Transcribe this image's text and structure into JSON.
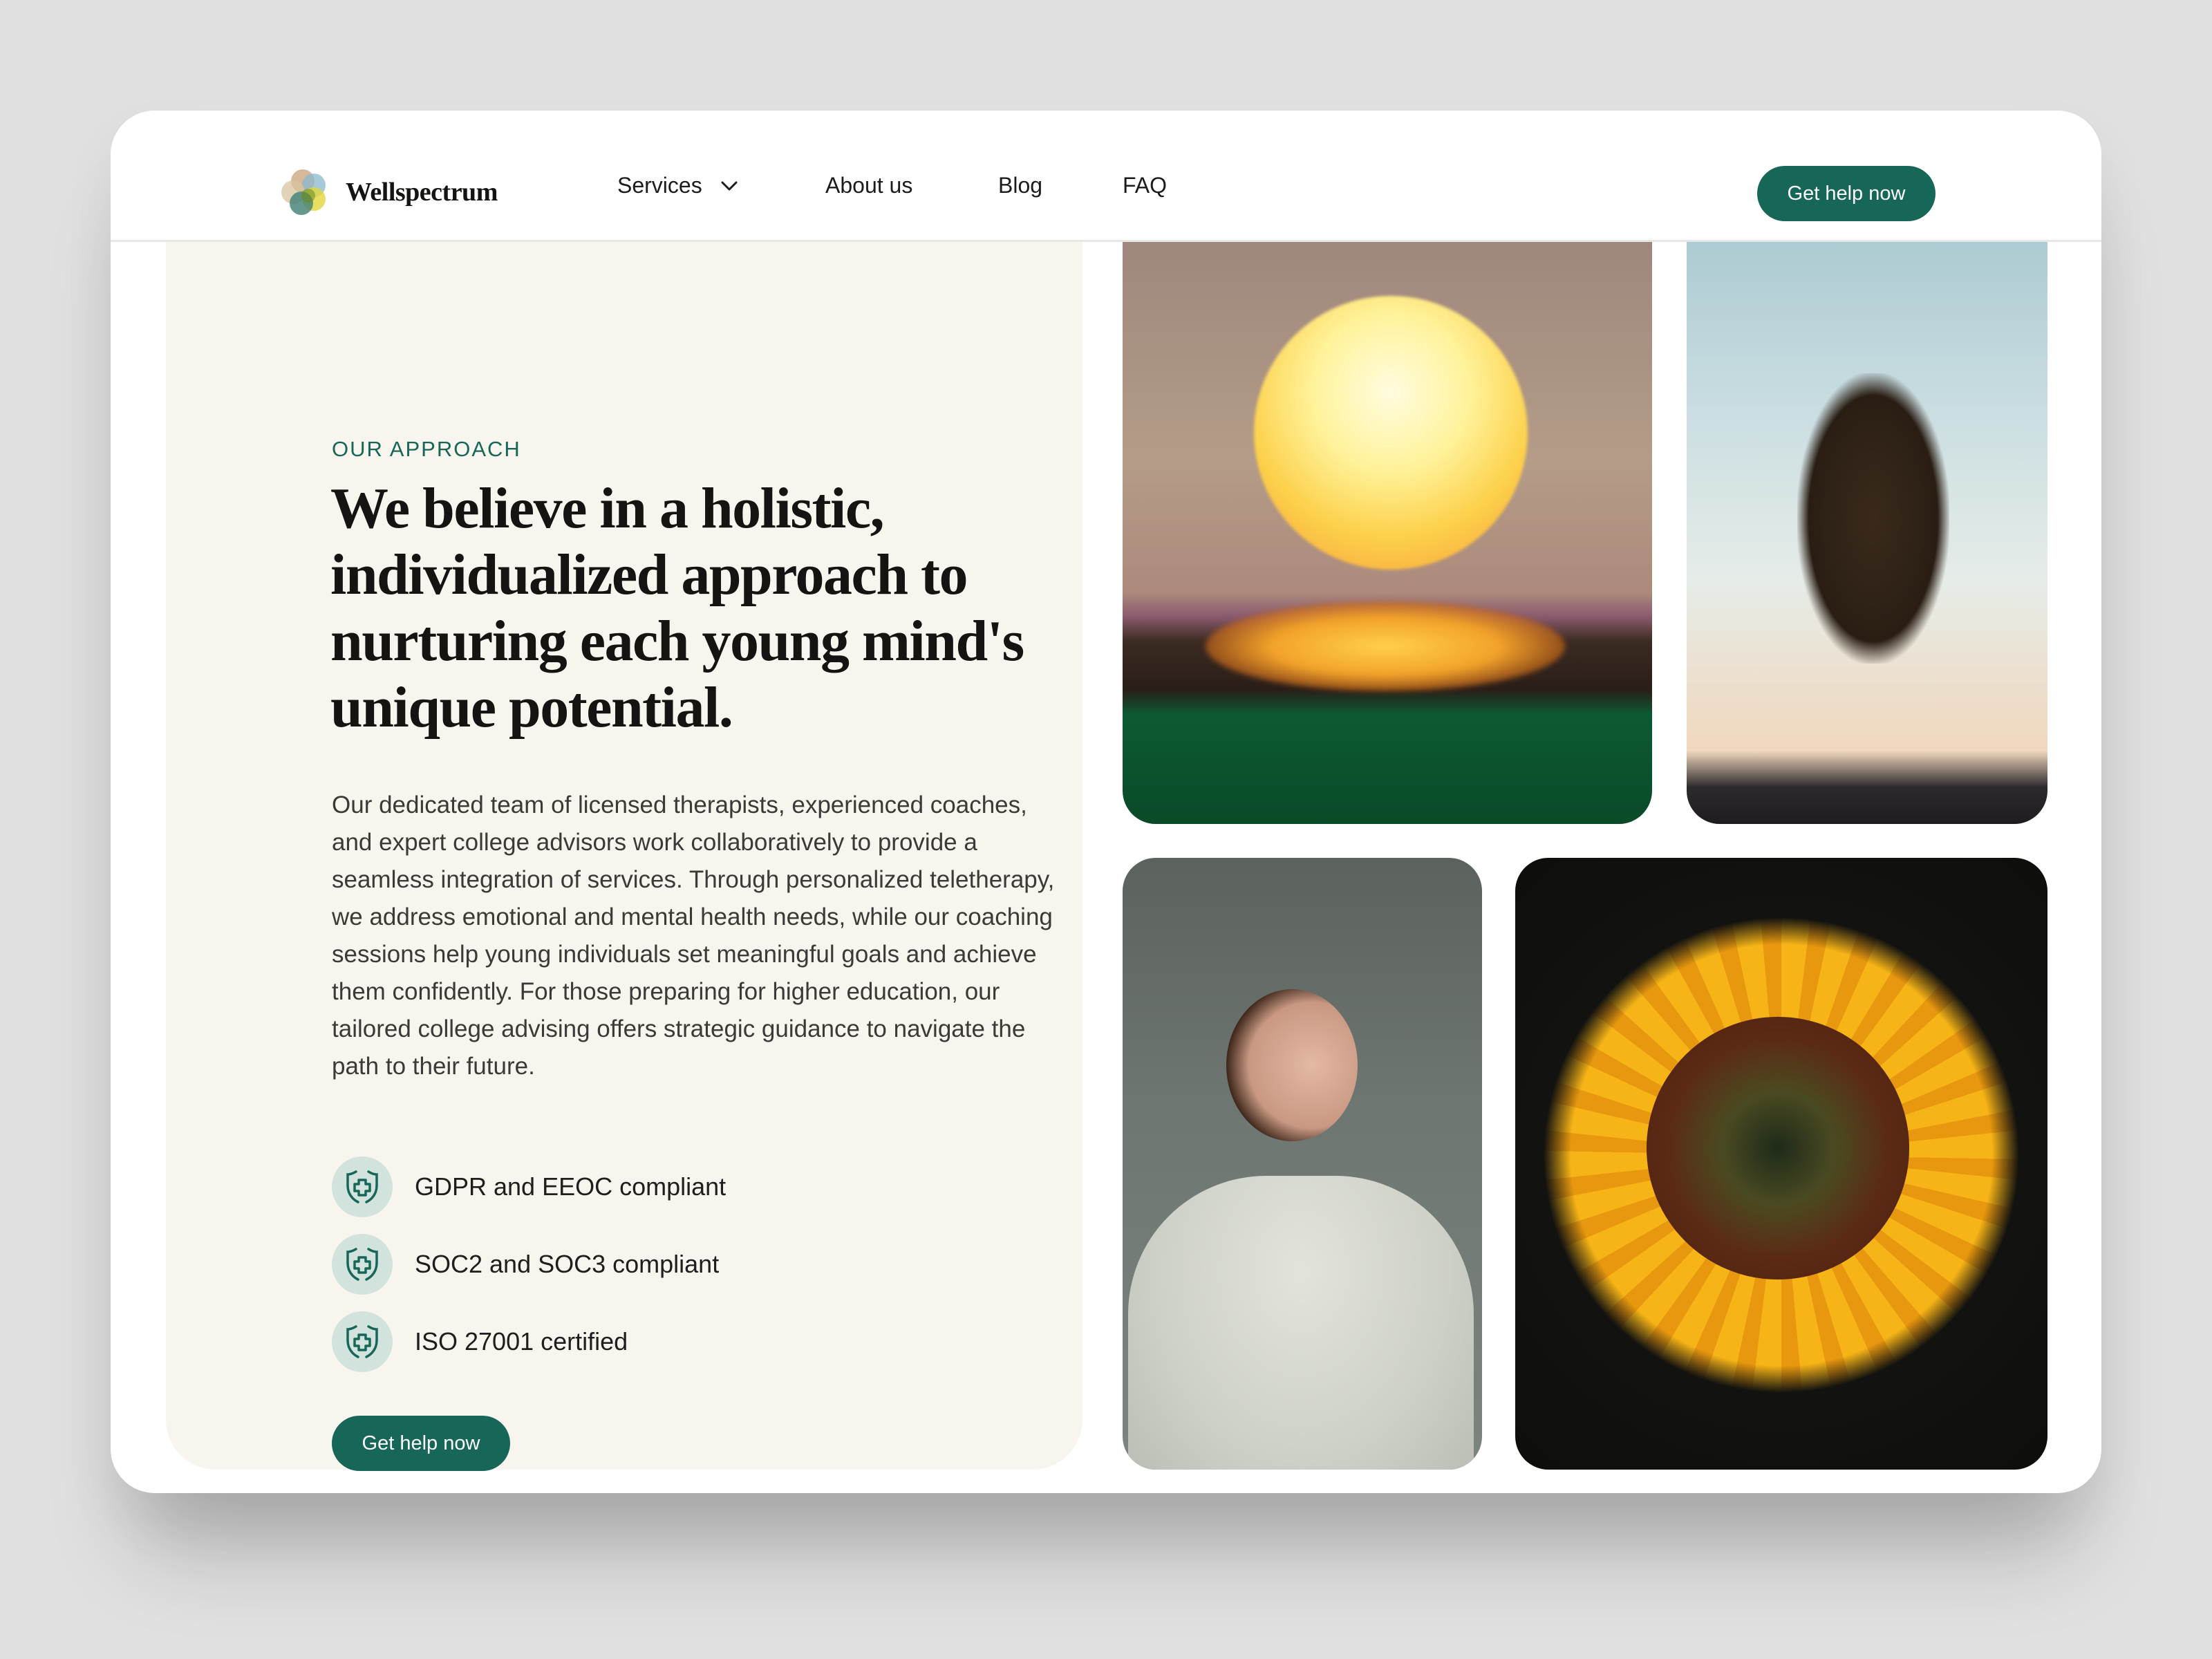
{
  "header": {
    "brand": "Wellspectrum",
    "nav": [
      {
        "label": "Services",
        "has_dropdown": true
      },
      {
        "label": "About us"
      },
      {
        "label": "Blog"
      },
      {
        "label": "FAQ"
      }
    ],
    "cta_label": "Get help now"
  },
  "main": {
    "eyebrow": "OUR APPROACH",
    "heading": "We believe in a holistic, individualized approach to nurturing each young mind's unique potential.",
    "body": "Our dedicated team of licensed therapists, experienced coaches, and expert college advisors work collaboratively to provide a seamless integration of services. Through personalized teletherapy, we address emotional and mental health needs, while our coaching sessions help young individuals set meaningful goals and achieve them confidently. For those preparing for higher education, our tailored college advising offers strategic guidance to navigate the path to their future.",
    "compliance": [
      {
        "icon": "shield-plus-icon",
        "label": "GDPR and EEOC compliant"
      },
      {
        "icon": "shield-plus-icon",
        "label": "SOC2 and SOC3 compliant"
      },
      {
        "icon": "shield-plus-icon",
        "label": "ISO 27001 certified"
      }
    ],
    "cta_label": "Get help now"
  },
  "gallery": [
    {
      "subject": "sunset over ocean"
    },
    {
      "subject": "woman jumping at dusk"
    },
    {
      "subject": "young man breathing outdoors"
    },
    {
      "subject": "sunflower"
    }
  ],
  "colors": {
    "accent": "#176759",
    "panel": "#f8f4ee",
    "icon_bg": "#d2e2dc",
    "page_bg": "#e0e0e0"
  }
}
